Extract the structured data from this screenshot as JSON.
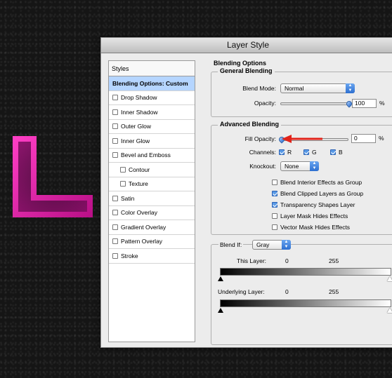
{
  "window": {
    "title": "Layer Style"
  },
  "colors": {
    "letter": "#d8169a",
    "selected": "#b5d5ff",
    "arrow": "#e2231a",
    "accent": "#3d7ad6"
  },
  "sidebar": {
    "header": "Styles",
    "items": [
      {
        "label": "Blending Options: Custom",
        "checkbox": false,
        "checked": false,
        "selected": true
      },
      {
        "label": "Drop Shadow",
        "checkbox": true,
        "checked": false
      },
      {
        "label": "Inner Shadow",
        "checkbox": true,
        "checked": false
      },
      {
        "label": "Outer Glow",
        "checkbox": true,
        "checked": false
      },
      {
        "label": "Inner Glow",
        "checkbox": true,
        "checked": false
      },
      {
        "label": "Bevel and Emboss",
        "checkbox": true,
        "checked": false
      },
      {
        "label": "Contour",
        "checkbox": true,
        "checked": false,
        "sub": true
      },
      {
        "label": "Texture",
        "checkbox": true,
        "checked": false,
        "sub": true
      },
      {
        "label": "Satin",
        "checkbox": true,
        "checked": false
      },
      {
        "label": "Color Overlay",
        "checkbox": true,
        "checked": false
      },
      {
        "label": "Gradient Overlay",
        "checkbox": true,
        "checked": false
      },
      {
        "label": "Pattern Overlay",
        "checkbox": true,
        "checked": false
      },
      {
        "label": "Stroke",
        "checkbox": true,
        "checked": false
      }
    ]
  },
  "blending": {
    "section_title": "Blending Options",
    "general": {
      "title": "General Blending",
      "blend_mode_label": "Blend Mode:",
      "blend_mode_value": "Normal",
      "opacity_label": "Opacity:",
      "opacity_value": "100",
      "opacity_unit": "%",
      "opacity_fraction": 1.0
    },
    "advanced": {
      "title": "Advanced Blending",
      "fill_opacity_label": "Fill Opacity:",
      "fill_opacity_value": "0",
      "fill_opacity_unit": "%",
      "fill_opacity_fraction": 0.0,
      "channels_label": "Channels:",
      "channels": [
        {
          "label": "R",
          "checked": true
        },
        {
          "label": "G",
          "checked": true
        },
        {
          "label": "B",
          "checked": true
        }
      ],
      "knockout_label": "Knockout:",
      "knockout_value": "None",
      "options": [
        {
          "label": "Blend Interior Effects as Group",
          "checked": false
        },
        {
          "label": "Blend Clipped Layers as Group",
          "checked": true
        },
        {
          "label": "Transparency Shapes Layer",
          "checked": true
        },
        {
          "label": "Layer Mask Hides Effects",
          "checked": false
        },
        {
          "label": "Vector Mask Hides Effects",
          "checked": false
        }
      ]
    },
    "blend_if": {
      "label": "Blend If:",
      "value": "Gray",
      "this_layer_label": "This Layer:",
      "this_layer_min": "0",
      "this_layer_max": "255",
      "underlying_label": "Underlying Layer:",
      "underlying_min": "0",
      "underlying_max": "255"
    }
  }
}
